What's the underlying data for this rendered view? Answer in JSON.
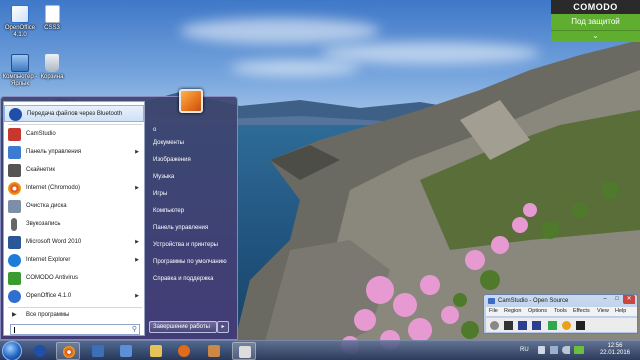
{
  "desktop_icons": [
    {
      "label": "OpenOffice 4.1.0",
      "color": "#2f6fd0",
      "icon": "openoffice-icon"
    },
    {
      "label": "CSS3",
      "color": "#ffffff",
      "icon": "file-icon"
    },
    {
      "label": "Компьютер - Ярлык",
      "color": "#4a7fc4",
      "icon": "computer-icon"
    },
    {
      "label": "Корзина",
      "color": "#cfd8e3",
      "icon": "recycle-bin-icon"
    }
  ],
  "comodo": {
    "brand": "COMODO",
    "status": "Под защитой",
    "chevron": "⌄",
    "status_color": "#5fae2f"
  },
  "start_menu": {
    "items": [
      {
        "label": "Передача файлов через Bluetooth",
        "icon": "bluetooth-icon",
        "color": "#1f4fa8",
        "arrow": false
      },
      {
        "label": "CamStudio",
        "icon": "camstudio-icon",
        "color": "#c8372d",
        "arrow": false
      },
      {
        "label": "Панель управления",
        "icon": "control-panel-icon",
        "color": "#3b7bd1",
        "arrow": true
      },
      {
        "label": "Скайнетик",
        "icon": "app-icon",
        "color": "#555555",
        "arrow": false
      },
      {
        "label": "Internet (Chromodo)",
        "icon": "chromodo-icon",
        "color": "#d84a1b",
        "arrow": true
      },
      {
        "label": "Очистка диска",
        "icon": "disk-cleanup-icon",
        "color": "#7c8ea8",
        "arrow": false
      },
      {
        "label": "Звукозапись",
        "icon": "microphone-icon",
        "color": "#666666",
        "arrow": false
      },
      {
        "label": "Microsoft Word 2010",
        "icon": "word-icon",
        "color": "#2b5797",
        "arrow": true
      },
      {
        "label": "Internet Explorer",
        "icon": "ie-icon",
        "color": "#1e7bd8",
        "arrow": true
      },
      {
        "label": "COMODO Antivirus",
        "icon": "comodo-icon",
        "color": "#3a9b2f",
        "arrow": false
      },
      {
        "label": "OpenOffice 4.1.0",
        "icon": "openoffice-icon",
        "color": "#2f6fd0",
        "arrow": true
      }
    ],
    "all_programs": "Все программы",
    "search_placeholder": "",
    "right_items": [
      "o",
      "Документы",
      "Изображения",
      "Музыка",
      "Игры",
      "Компьютер",
      "Панель управления",
      "Устройства и принтеры",
      "Программы по умолчанию",
      "Справка и поддержка"
    ],
    "shutdown_label": "Завершение работы",
    "shutdown_arrow": "▸"
  },
  "camstudio": {
    "title": "CamStudio - Open Source",
    "controls": [
      "–",
      "□",
      "✕"
    ],
    "menu": [
      "File",
      "Region",
      "Options",
      "Tools",
      "Effects",
      "View",
      "Help"
    ],
    "tool_colors": [
      "#888888",
      "#333333",
      "#2c3e8f",
      "#2c3e8f",
      "#2ea84a",
      "#e8a21a",
      "#222222"
    ]
  },
  "taskbar": {
    "buttons": [
      {
        "icon": "bluetooth-icon",
        "color": "#1f4fa8",
        "active": false
      },
      {
        "icon": "chromodo-icon",
        "color": "#d84a1b",
        "active": true
      },
      {
        "icon": "app-icon",
        "color": "#3b6fb6",
        "active": false
      },
      {
        "icon": "control-panel-icon",
        "color": "#5b8fd6",
        "active": false
      },
      {
        "icon": "folder-icon",
        "color": "#e7c25a",
        "active": false
      },
      {
        "icon": "media-player-icon",
        "color": "#e06c1a",
        "active": false
      },
      {
        "icon": "paint-icon",
        "color": "#cc8844",
        "active": false
      },
      {
        "icon": "camstudio-icon",
        "color": "#dddddd",
        "active": true
      }
    ],
    "tray_lang": "RU",
    "time": "12:56",
    "date": "22.01.2016"
  }
}
